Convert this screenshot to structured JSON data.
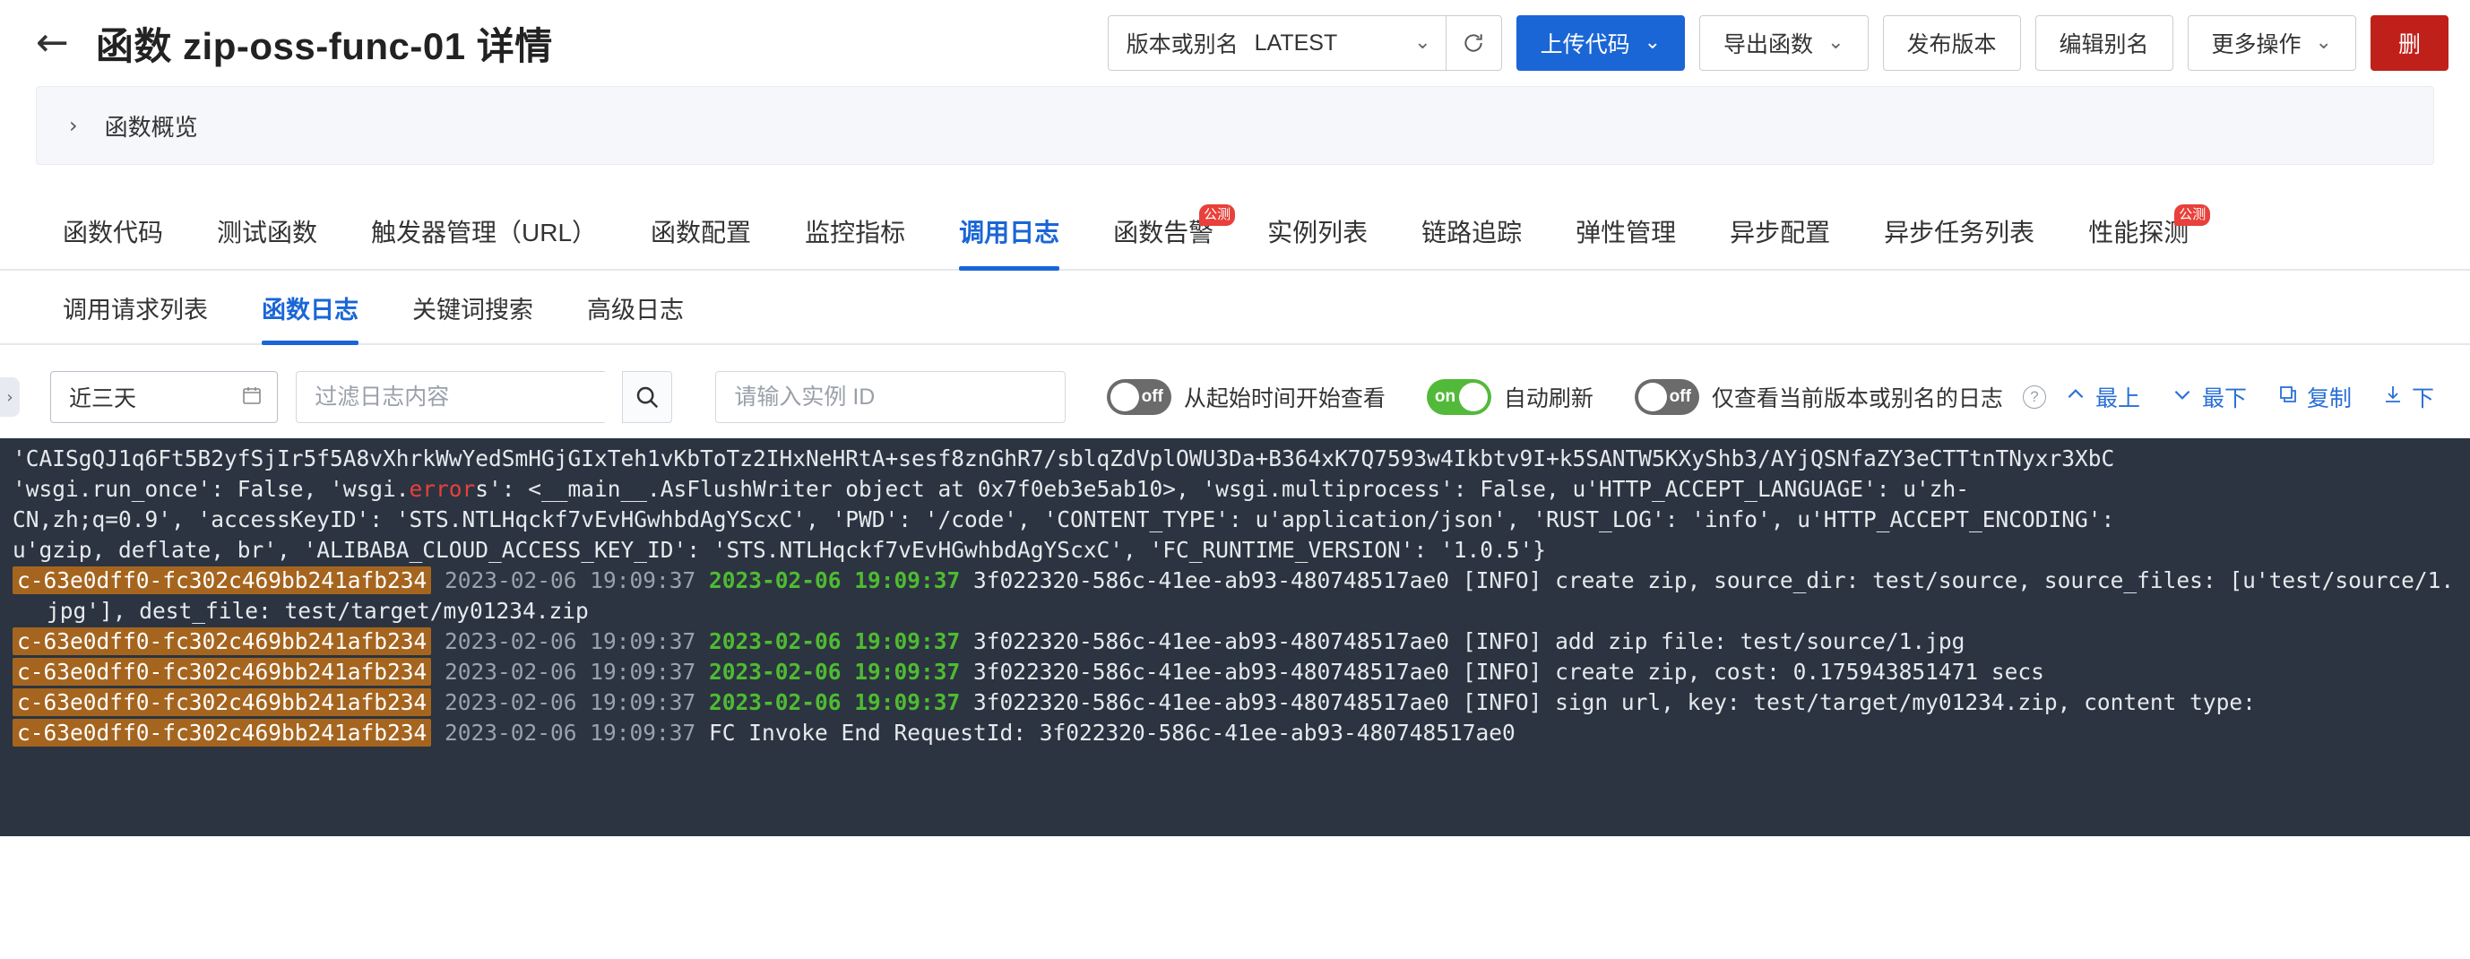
{
  "header": {
    "back_icon": "arrow-left-icon",
    "title": "函数 zip-oss-func-01 详情",
    "version_label": "版本或别名",
    "version_value": "LATEST",
    "refresh_icon": "refresh-icon",
    "buttons": {
      "upload_code": "上传代码",
      "export_function": "导出函数",
      "publish_version": "发布版本",
      "edit_alias": "编辑别名",
      "more_actions": "更多操作",
      "delete": "删"
    }
  },
  "overview": {
    "chevron_icon": "chevron-right-icon",
    "label": "函数概览"
  },
  "tabs": [
    {
      "label": "函数代码",
      "active": false,
      "badge": ""
    },
    {
      "label": "测试函数",
      "active": false,
      "badge": ""
    },
    {
      "label": "触发器管理（URL）",
      "active": false,
      "badge": ""
    },
    {
      "label": "函数配置",
      "active": false,
      "badge": ""
    },
    {
      "label": "监控指标",
      "active": false,
      "badge": ""
    },
    {
      "label": "调用日志",
      "active": true,
      "badge": ""
    },
    {
      "label": "函数告警",
      "active": false,
      "badge": "公测"
    },
    {
      "label": "实例列表",
      "active": false,
      "badge": ""
    },
    {
      "label": "链路追踪",
      "active": false,
      "badge": ""
    },
    {
      "label": "弹性管理",
      "active": false,
      "badge": ""
    },
    {
      "label": "异步配置",
      "active": false,
      "badge": ""
    },
    {
      "label": "异步任务列表",
      "active": false,
      "badge": ""
    },
    {
      "label": "性能探测",
      "active": false,
      "badge": "公测"
    }
  ],
  "subtabs": [
    {
      "label": "调用请求列表",
      "active": false
    },
    {
      "label": "函数日志",
      "active": true
    },
    {
      "label": "关键词搜索",
      "active": false
    },
    {
      "label": "高级日志",
      "active": false
    }
  ],
  "filterbar": {
    "collapse_icon": "chevron-right-icon",
    "date_value": "近三天",
    "calendar_icon": "calendar-icon",
    "filter_placeholder": "过滤日志内容",
    "filter_value": "",
    "search_icon": "search-icon",
    "instance_placeholder": "请输入实例 ID",
    "instance_value": "",
    "switch_start_time": {
      "state": "off",
      "label": "从起始时间开始查看"
    },
    "switch_auto_refresh": {
      "state": "on",
      "label": "自动刷新"
    },
    "switch_current_version": {
      "state": "off",
      "label": "仅查看当前版本或别名的日志"
    },
    "help_icon": "question-circle-icon",
    "actions": [
      {
        "icon": "chevron-up-icon",
        "label": "最上"
      },
      {
        "icon": "chevron-down-icon",
        "label": "最下"
      },
      {
        "icon": "copy-icon",
        "label": "复制"
      },
      {
        "icon": "download-icon",
        "label": "下"
      }
    ]
  },
  "console": {
    "container_id": "c-63e0dff0-fc302c469bb241afb234",
    "grey_timestamp": "2023-02-06 19:09:37",
    "green_timestamp": "2023-02-06 19:09:37",
    "request_id": "3f022320-586c-41ee-ab93-480748517ae0",
    "lines": [
      {
        "type": "raw",
        "segments": [
          {
            "cls": "plain",
            "text": "'CAISgQJ1q6Ft5B2yfSjIr5f5A8vXhrkWwYedSmHGjGIxTeh1vKbToTz2IHxNeHRtA+sesf8znGhR7/sblqZdVplOWU3Da+B364xK7Q7593w4Ikbtv9I+k5SANTW5KXyShb3/AYjQSNfaZY3eCTTtnTNyxr3XbC"
          }
        ]
      },
      {
        "type": "raw",
        "segments": [
          {
            "cls": "plain",
            "text": "'wsgi.run_once': False, 'wsgi."
          },
          {
            "cls": "err",
            "text": "error"
          },
          {
            "cls": "plain",
            "text": "s': <__main__.AsFlushWriter object at 0x7f0eb3e5ab10>, 'wsgi.multiprocess': False, u'HTTP_ACCEPT_LANGUAGE': u'zh-"
          }
        ]
      },
      {
        "type": "raw",
        "segments": [
          {
            "cls": "plain",
            "text": "CN,zh;q=0.9', 'accessKeyID': 'STS.NTLHqckf7vEvHGwhbdAgYScxC', 'PWD': '/code', 'CONTENT_TYPE': u'application/json', 'RUST_LOG': 'info', u'HTTP_ACCEPT_ENCODING':"
          }
        ]
      },
      {
        "type": "raw",
        "segments": [
          {
            "cls": "plain",
            "text": "u'gzip, deflate, br', 'ALIBABA_CLOUD_ACCESS_KEY_ID': 'STS.NTLHqckf7vEvHGwhbdAgYScxC', 'FC_RUNTIME_VERSION': '1.0.5'}"
          }
        ]
      },
      {
        "type": "entry",
        "has_green": true,
        "message": "[INFO] create zip, source_dir: test/source, source_files: [u'test/source/1.jpg'], dest_file: test/target/my01234.zip"
      },
      {
        "type": "entry",
        "has_green": true,
        "message": "[INFO] add zip file: test/source/1.jpg"
      },
      {
        "type": "entry",
        "has_green": true,
        "message": "[INFO] create zip, cost: 0.175943851471 secs"
      },
      {
        "type": "entry",
        "has_green": true,
        "message": "[INFO] sign url, key: test/target/my01234.zip, content type:"
      },
      {
        "type": "entry",
        "has_green": false,
        "message": "FC Invoke End RequestId: 3f022320-586c-41ee-ab93-480748517ae0"
      }
    ]
  },
  "colors": {
    "accent": "#1a66d6",
    "danger": "#c0201a",
    "success": "#53b93a",
    "console_bg": "#2b3440",
    "cid_highlight": "#a5651f",
    "ts_green": "#4fbb32",
    "error_red": "#e8403a"
  }
}
